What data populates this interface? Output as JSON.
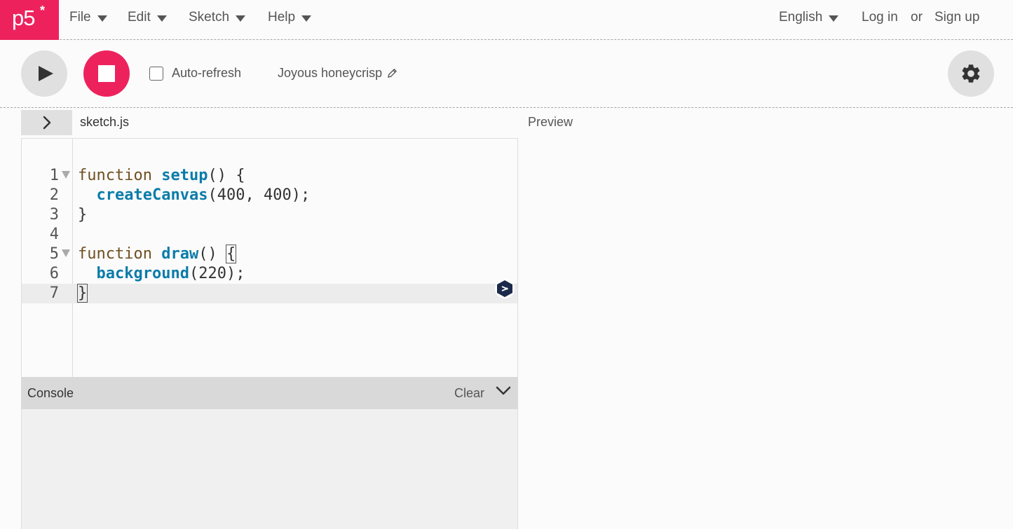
{
  "logo": {
    "text": "p5",
    "star": "*"
  },
  "menu": [
    {
      "label": "File"
    },
    {
      "label": "Edit"
    },
    {
      "label": "Sketch"
    },
    {
      "label": "Help"
    }
  ],
  "nav_right": {
    "language": "English",
    "login": "Log in",
    "or": "or",
    "signup": "Sign up"
  },
  "toolbar": {
    "play_icon": "play-icon",
    "stop_icon": "stop-icon",
    "auto_refresh_label": "Auto-refresh",
    "auto_refresh_checked": false,
    "sketch_name": "Joyous honeycrisp",
    "edit_icon": "pencil-icon",
    "settings_icon": "gear-icon"
  },
  "editor": {
    "file_name": "sketch.js",
    "preview_label": "Preview",
    "lines": [
      {
        "n": "1",
        "text": "function setup() {"
      },
      {
        "n": "2",
        "text": "  createCanvas(400, 400);"
      },
      {
        "n": "3",
        "text": "}"
      },
      {
        "n": "4",
        "text": ""
      },
      {
        "n": "5",
        "text": "function draw() {"
      },
      {
        "n": "6",
        "text": "  background(220);"
      },
      {
        "n": "7",
        "text": "}"
      }
    ]
  },
  "console": {
    "title": "Console",
    "clear_label": "Clear"
  },
  "colors": {
    "accent": "#ed225d",
    "keyword": "#704f21",
    "function": "#0b7ca9"
  }
}
